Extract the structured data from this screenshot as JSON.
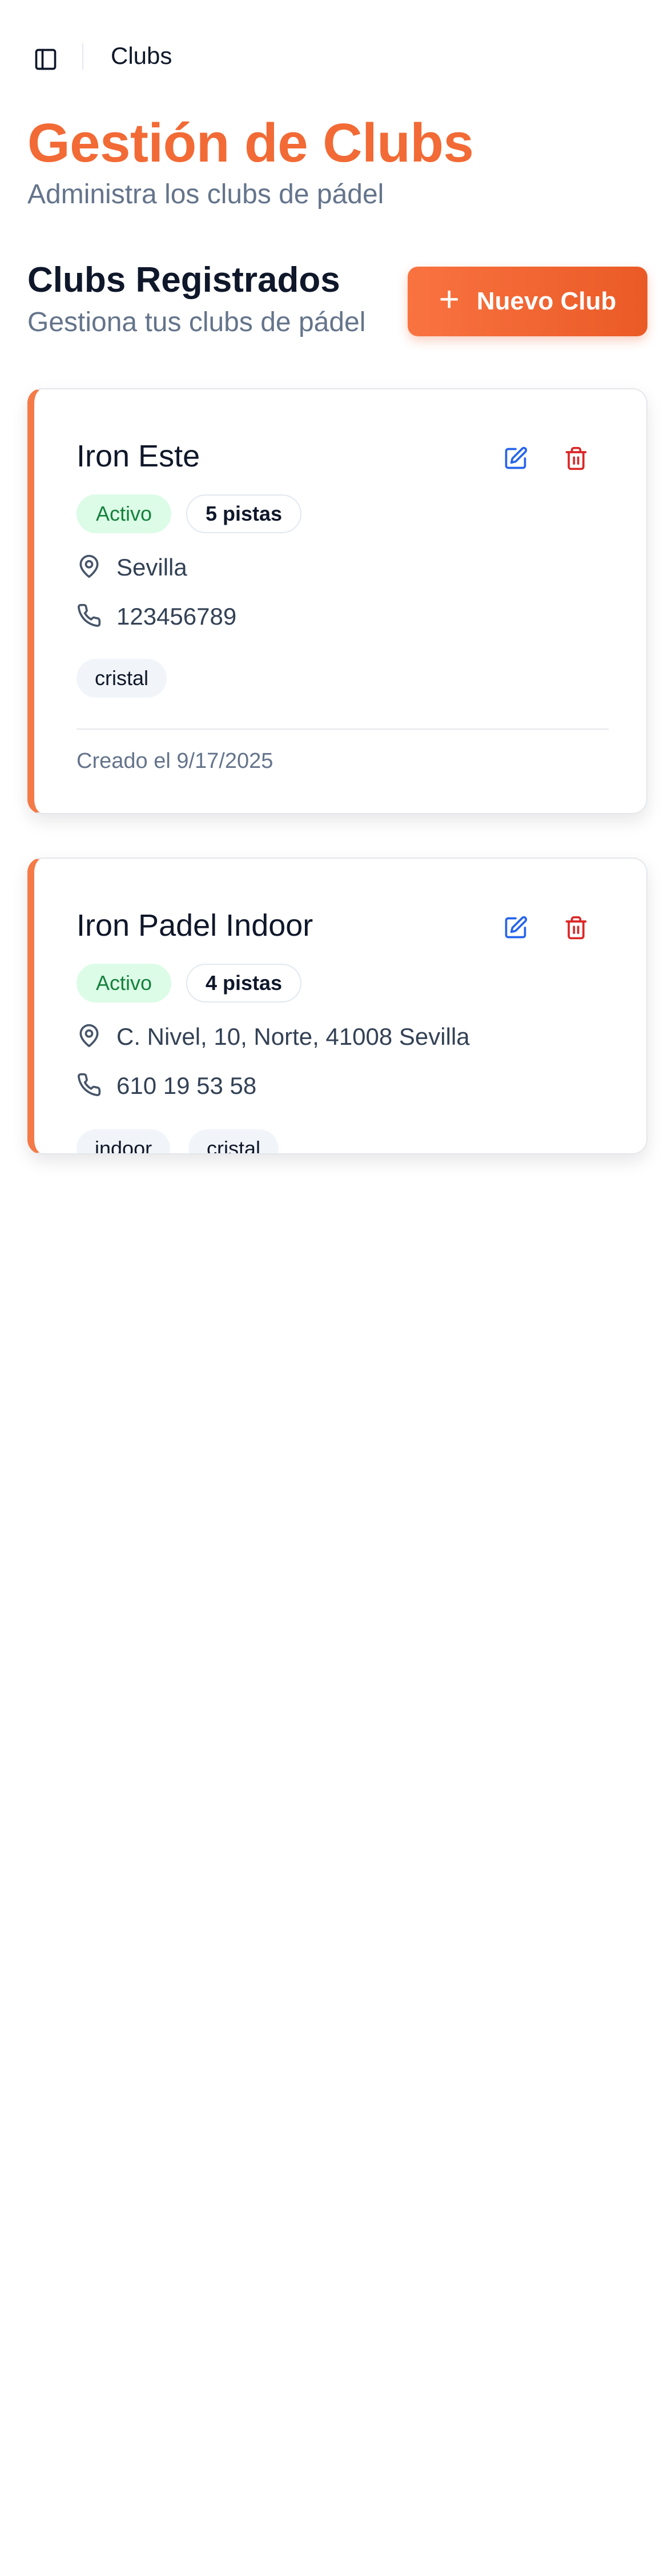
{
  "header": {
    "breadcrumb": "Clubs",
    "sidebar_icon": "sidebar-toggle-icon"
  },
  "page": {
    "title": "Gestión de Clubs",
    "subtitle": "Administra los clubs de pádel"
  },
  "section": {
    "title": "Clubs Registrados",
    "subtitle": "Gestiona tus clubs de pádel",
    "new_button_icon": "+",
    "new_button_label": "Nuevo Club"
  },
  "clubs": [
    {
      "name": "Iron Este",
      "status": "Activo",
      "courts": "5 pistas",
      "location": "Sevilla",
      "phone": "123456789",
      "tags": [
        "cristal"
      ],
      "created": "Creado el 9/17/2025"
    },
    {
      "name": "Iron Padel Indoor",
      "status": "Activo",
      "courts": "4 pistas",
      "location": "C. Nivel, 10, Norte, 41008 Sevilla",
      "phone": "610 19 53 58",
      "tags": [
        "indoor",
        "cristal"
      ]
    }
  ],
  "colors": {
    "accent": "#f26a35",
    "button_gradient_start": "#f97341",
    "button_gradient_end": "#ea5a26",
    "card_border_accent": "#f47a48",
    "active_badge_bg": "#dcfce7",
    "active_badge_text": "#15803d",
    "edit_icon": "#2563eb",
    "delete_icon": "#dc2626",
    "muted_text": "#64748b"
  }
}
